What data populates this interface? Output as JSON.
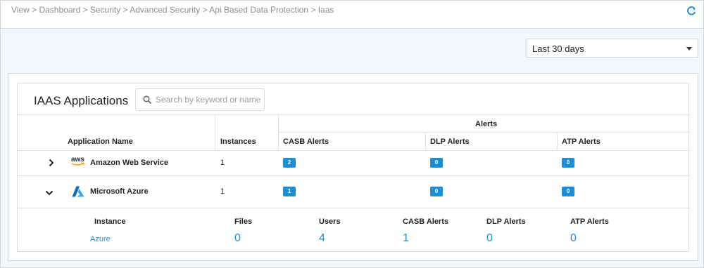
{
  "breadcrumb": "View > Dashboard > Security > Advanced Security > Api Based Data Protection > Iaas",
  "time_range": {
    "selected": "Last 30 days"
  },
  "panel": {
    "title": "IAAS Applications",
    "search_placeholder": "Search by keyword or name"
  },
  "table": {
    "group_header": "Alerts",
    "headers": {
      "application_name": "Application Name",
      "instances": "Instances",
      "casb_alerts": "CASB Alerts",
      "dlp_alerts": "DLP Alerts",
      "atp_alerts": "ATP Alerts"
    },
    "rows": [
      {
        "name": "Amazon Web Service",
        "logo_text": "aws",
        "instances": "1",
        "casb": "2",
        "dlp": "0",
        "atp": "0",
        "expanded": false
      },
      {
        "name": "Microsoft Azure",
        "instances": "1",
        "casb": "1",
        "dlp": "0",
        "atp": "0",
        "expanded": true
      }
    ]
  },
  "detail": {
    "headers": {
      "instance": "Instance",
      "files": "Files",
      "users": "Users",
      "casb": "CASB Alerts",
      "dlp": "DLP Alerts",
      "atp": "ATP Alerts"
    },
    "row": {
      "instance": "Azure",
      "files": "0",
      "users": "4",
      "casb": "1",
      "dlp": "0",
      "atp": "0"
    }
  },
  "colors": {
    "accent": "#1a8fd6",
    "aws_orange": "#ff9900",
    "azure_blue": "#0a6fc2"
  }
}
